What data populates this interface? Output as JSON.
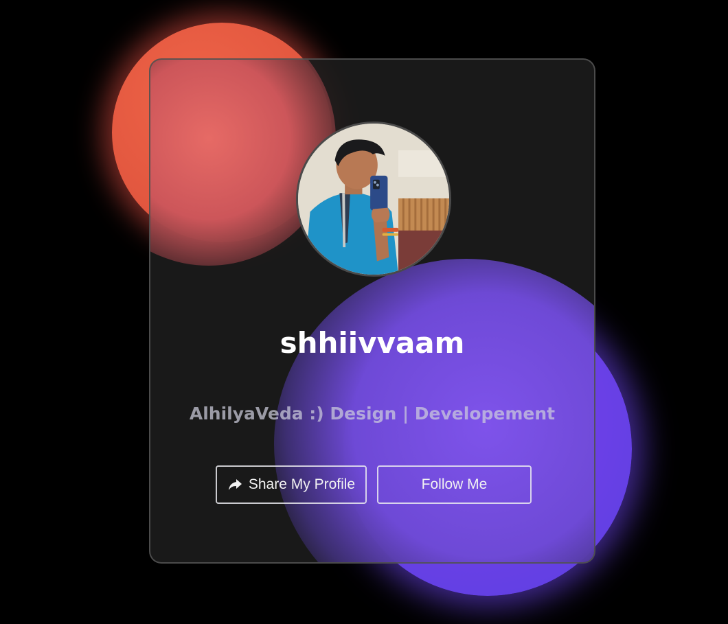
{
  "profile": {
    "name": "shhiivvaam",
    "tagline": "AlhilyaVeda :) Design | Developement"
  },
  "buttons": {
    "share_label": "Share My Profile",
    "follow_label": "Follow Me"
  },
  "icons": {
    "share": "share-icon"
  },
  "colors": {
    "background": "#000000",
    "blob_red": "#e85a46",
    "blob_purple": "#6a45e8",
    "card": "#1c1c1c",
    "name_text": "#ffffff",
    "button_border": "#ebebf0"
  }
}
